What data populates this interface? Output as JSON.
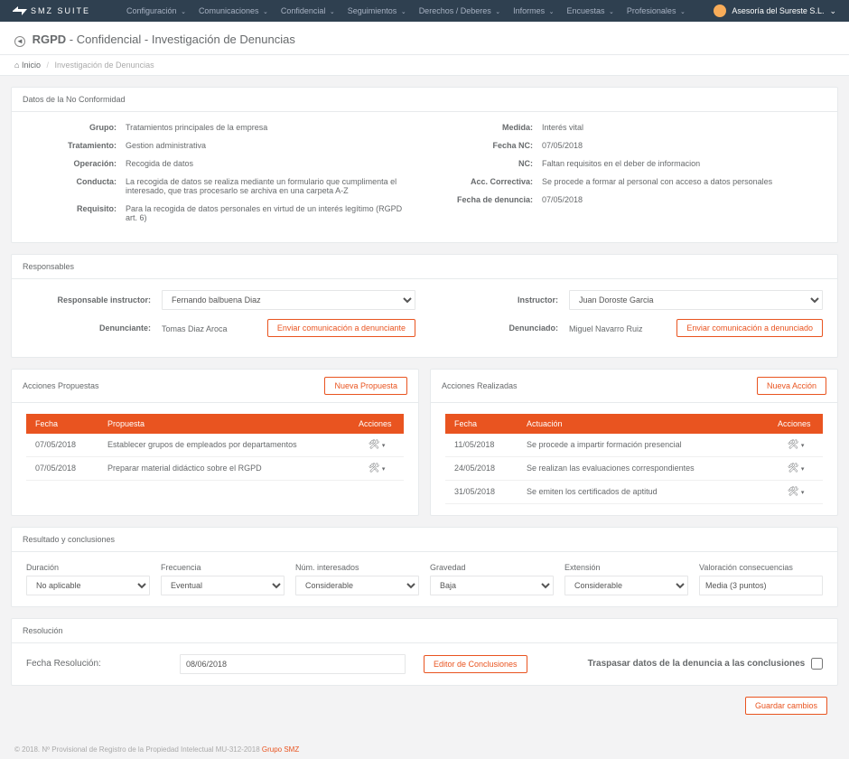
{
  "brand": "SMZ SUITE",
  "nav": [
    "Configuración",
    "Comunicaciones",
    "Confidencial",
    "Seguimientos",
    "Derechos / Deberes",
    "Informes",
    "Encuestas",
    "Profesionales"
  ],
  "tenant": "Asesoría del Sureste S.L.",
  "title": {
    "b": "RGPD",
    "rest": " - Confidencial - Investigación de Denuncias"
  },
  "crumbs": {
    "home": "Inicio",
    "cur": "Investigación de Denuncias"
  },
  "p1": {
    "title": "Datos de la No Conformidad",
    "left": [
      {
        "k": "Grupo:",
        "v": "Tratamientos principales de la empresa"
      },
      {
        "k": "Tratamiento:",
        "v": "Gestion administrativa"
      },
      {
        "k": "Operación:",
        "v": "Recogida de datos"
      },
      {
        "k": "Conducta:",
        "v": "La recogida de datos se realiza mediante un formulario que cumplimenta el interesado, que tras procesarlo se archiva en una carpeta A-Z"
      },
      {
        "k": "Requisito:",
        "v": "Para la recogida de datos personales en virtud de un interés legítimo (RGPD art. 6)"
      }
    ],
    "right": [
      {
        "k": "Medida:",
        "v": "Interés vital"
      },
      {
        "k": "Fecha NC:",
        "v": "07/05/2018"
      },
      {
        "k": "NC:",
        "v": "Faltan requisitos en el deber de informacion"
      },
      {
        "k": "Acc. Correctiva:",
        "v": "Se procede a formar al personal con acceso a datos personales"
      },
      {
        "k": "Fecha de denuncia:",
        "v": "07/05/2018"
      }
    ]
  },
  "p2": {
    "title": "Responsables",
    "rinst_l": "Responsable instructor:",
    "rinst_v": "Fernando balbuena Diaz",
    "denu_l": "Denunciante:",
    "denu_v": "Tomas Diaz Aroca",
    "btn1": "Enviar comunicación a denunciante",
    "inst_l": "Instructor:",
    "inst_v": "Juan Doroste Garcia",
    "dend_l": "Denunciado:",
    "dend_v": "Miguel Navarro Ruiz",
    "btn2": "Enviar comunicación a denunciado"
  },
  "tprop": {
    "title": "Acciones Propuestas",
    "new": "Nueva Propuesta",
    "h": [
      "Fecha",
      "Propuesta",
      "Acciones"
    ],
    "rows": [
      {
        "f": "07/05/2018",
        "p": "Establecer grupos de empleados por departamentos"
      },
      {
        "f": "07/05/2018",
        "p": "Preparar material didáctico sobre el RGPD"
      }
    ]
  },
  "treal": {
    "title": "Acciones Realizadas",
    "new": "Nueva Acción",
    "h": [
      "Fecha",
      "Actuación",
      "Acciones"
    ],
    "rows": [
      {
        "f": "11/05/2018",
        "p": "Se procede a impartir formación presencial"
      },
      {
        "f": "24/05/2018",
        "p": "Se realizan las evaluaciones correspondientes"
      },
      {
        "f": "31/05/2018",
        "p": "Se emiten los certificados de aptitud"
      }
    ]
  },
  "res": {
    "title": "Resultado y conclusiones",
    "fields": [
      {
        "l": "Duración",
        "v": "No aplicable"
      },
      {
        "l": "Frecuencia",
        "v": "Eventual"
      },
      {
        "l": "Núm. interesados",
        "v": "Considerable"
      },
      {
        "l": "Gravedad",
        "v": "Baja"
      },
      {
        "l": "Extensión",
        "v": "Considerable"
      },
      {
        "l": "Valoración consecuencias",
        "v": "Media (3 puntos)"
      }
    ]
  },
  "resol": {
    "title": "Resolución",
    "date_l": "Fecha Resolución:",
    "date_v": "08/06/2018",
    "btn": "Editor de Conclusiones",
    "transfer": "Traspasar datos de la denuncia a las conclusiones"
  },
  "save": "Guardar cambios",
  "footer": {
    "text": "© 2018. Nº Provisional de Registro de la Propiedad Intelectual MU-312-2018 ",
    "link": "Grupo SMZ"
  }
}
